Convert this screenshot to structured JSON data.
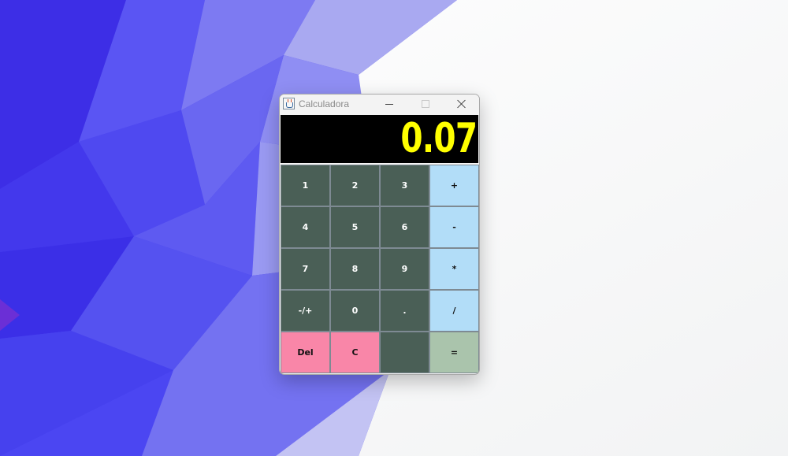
{
  "window": {
    "title": "Calculadora",
    "icon": "java-cup-icon"
  },
  "display": {
    "value": "0.07",
    "color": "#ffff00",
    "background": "#000000"
  },
  "keys": [
    {
      "label": "1"
    },
    {
      "label": "2"
    },
    {
      "label": "3"
    },
    {
      "label": "+"
    },
    {
      "label": "4"
    },
    {
      "label": "5"
    },
    {
      "label": "6"
    },
    {
      "label": "-"
    },
    {
      "label": "7"
    },
    {
      "label": "8"
    },
    {
      "label": "9"
    },
    {
      "label": "*"
    },
    {
      "label": "-/+"
    },
    {
      "label": "0"
    },
    {
      "label": "."
    },
    {
      "label": "/"
    },
    {
      "label": "Del"
    },
    {
      "label": "C"
    },
    {
      "label": ""
    },
    {
      "label": "="
    }
  ],
  "colors": {
    "number_key": "#4a5f56",
    "operator_key": "#b2ddf8",
    "delete_key": "#f986a8",
    "equals_key": "#aac4ac"
  }
}
